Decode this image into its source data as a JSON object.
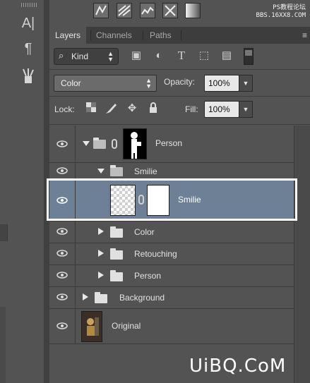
{
  "tabs": [
    {
      "label": "Layers"
    },
    {
      "label": "Channels"
    },
    {
      "label": "Paths"
    }
  ],
  "panel_menu_label": "≡",
  "filter": {
    "kind_label": "Kind"
  },
  "blend": {
    "mode": "Color",
    "opacity_label": "Opacity:",
    "opacity_value": "100%"
  },
  "lock": {
    "label": "Lock:",
    "fill_label": "Fill:",
    "fill_value": "100%"
  },
  "layers": [
    {
      "name": "Person",
      "type": "group-mask",
      "expanded": true
    },
    {
      "name": "Smilie",
      "type": "group",
      "expanded": true
    },
    {
      "name": "Smilie",
      "type": "layer-mask",
      "selected": true
    },
    {
      "name": "Color",
      "type": "group",
      "expanded": false
    },
    {
      "name": "Retouching",
      "type": "group",
      "expanded": false
    },
    {
      "name": "Person",
      "type": "group",
      "expanded": false
    },
    {
      "name": "Background",
      "type": "group",
      "expanded": false
    },
    {
      "name": "Original",
      "type": "image"
    }
  ],
  "left_tools": [
    {
      "glyph": "A|"
    },
    {
      "glyph": "¶"
    }
  ],
  "watermarks": {
    "top_line1": "PS教程论坛",
    "top_line2": "BBS.16XX8.COM",
    "bottom": "UiBQ.CoM"
  },
  "colors": {
    "panel_bg": "#535353",
    "selected_row": "#6d8096",
    "highlight_frame": "#ffffff"
  }
}
